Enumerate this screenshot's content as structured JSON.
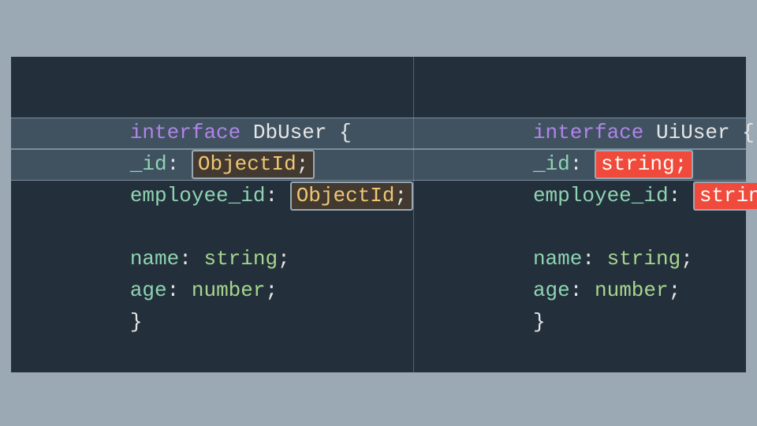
{
  "left": {
    "kw": "interface",
    "typeName": "DbUser",
    "open": " {",
    "close": "}",
    "lines": [
      {
        "prop": "_id",
        "type": "ObjectId",
        "hl": "objid"
      },
      {
        "prop": "employee_id",
        "type": "ObjectId",
        "hl": "objid"
      },
      null,
      {
        "prop": "name",
        "type": "string",
        "hl": "none"
      },
      {
        "prop": "age",
        "type": "number",
        "hl": "none"
      }
    ]
  },
  "right": {
    "kw": "interface",
    "typeName": "UiUser",
    "open": " {",
    "close": "}",
    "lines": [
      {
        "prop": "_id",
        "type": "string",
        "hl": "string"
      },
      {
        "prop": "employee_id",
        "type": "string",
        "hl": "string"
      },
      null,
      {
        "prop": "name",
        "type": "string",
        "hl": "none"
      },
      {
        "prop": "age",
        "type": "number",
        "hl": "none"
      }
    ]
  },
  "punct": {
    "colon": ": ",
    "semi": ";"
  }
}
